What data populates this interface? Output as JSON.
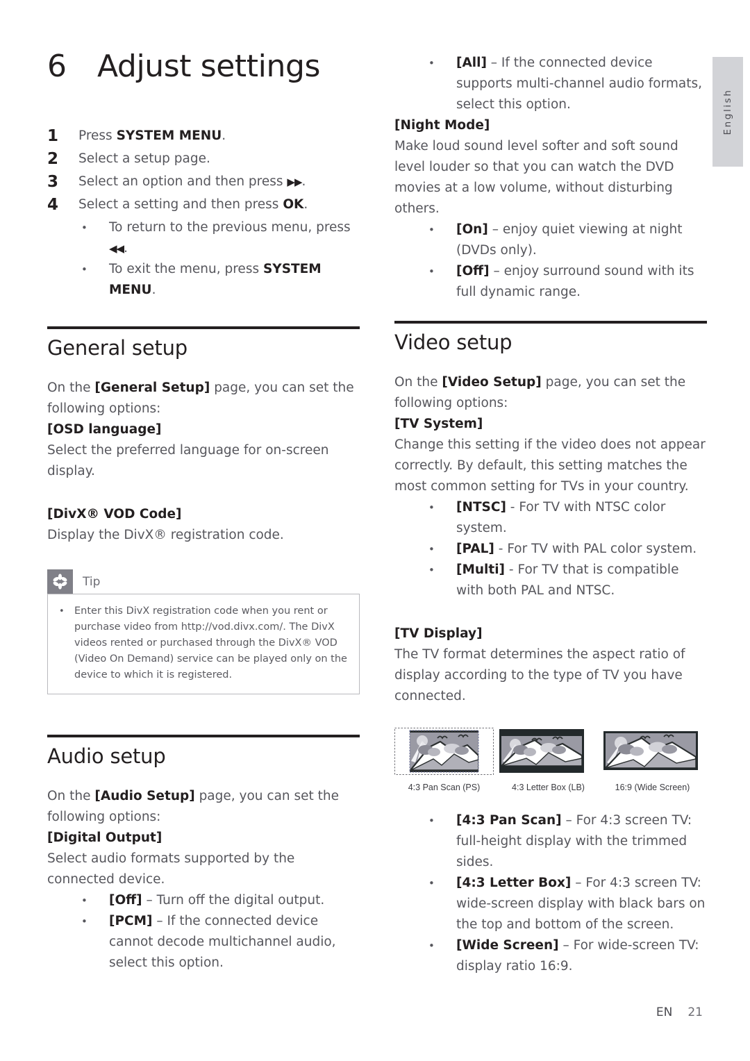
{
  "language_tab": {
    "label": "English"
  },
  "chapter": {
    "number": "6",
    "title": "Adjust settings"
  },
  "steps": [
    {
      "num": "1",
      "text_before": "Press ",
      "bold": "SYSTEM MENU",
      "text_after": "."
    },
    {
      "num": "2",
      "text_before": "Select a setup page.",
      "bold": "",
      "text_after": ""
    },
    {
      "num": "3",
      "text_before": "Select an option and then press ",
      "bold": "",
      "text_after": "."
    },
    {
      "num": "4",
      "text_before": "Select a setting and then press ",
      "bold": "OK",
      "text_after": "."
    }
  ],
  "substeps": [
    {
      "bullet": "•",
      "line1": "To return to the previous menu, press",
      "line2_glyph": "◀◀",
      "line2_after": "."
    },
    {
      "bullet": "•",
      "line1": "To exit the menu, press ",
      "bold": "SYSTEM MENU",
      "line2_after": "."
    }
  ],
  "general_setup": {
    "title": "General setup",
    "intro_before": "On the ",
    "intro_bold": "[General Setup]",
    "intro_after": " page, you can set the following options:",
    "osd_heading": "[OSD language]",
    "osd_body": "Select the preferred language for on-screen display.",
    "divx_heading": "[DivX® VOD Code]",
    "divx_body": "Display the DivX® registration code."
  },
  "tip": {
    "label": "Tip",
    "icon": "asterisk-icon",
    "items": [
      "Enter this DivX registration code when you rent or purchase video from http://vod.divx.com/. The DivX videos rented or purchased through the DivX® VOD (Video On Demand) service can be played only on the device to which it is registered."
    ]
  },
  "audio_setup": {
    "title": "Audio setup",
    "intro_before": "On the ",
    "intro_bold": "[Audio Setup]",
    "intro_after": " page, you can set the following options:",
    "digital_output_heading": "[Digital Output]",
    "digital_output_body": "Select audio formats supported by the connected device.",
    "options": [
      {
        "bold": "[Off]",
        "text": " – Turn off the digital output."
      },
      {
        "bold": "[PCM]",
        "text": " – If the connected device cannot decode multichannel audio, select this option."
      },
      {
        "bold": "[All]",
        "text": " – If the connected device supports multi-channel audio formats, select this option."
      }
    ],
    "night_mode_heading": "[Night Mode]",
    "night_mode_body": "Make loud sound level softer and soft sound level louder so that you can watch the DVD movies at a low volume, without disturbing others.",
    "night_mode_options": [
      {
        "bold": "[On]",
        "text": " – enjoy quiet viewing at night (DVDs only)."
      },
      {
        "bold": "[Off]",
        "text": " – enjoy surround sound with its full dynamic range."
      }
    ]
  },
  "video_setup": {
    "title": "Video setup",
    "intro_before": "On the ",
    "intro_bold": "[Video Setup]",
    "intro_after": " page, you can set the following options:",
    "tv_system_heading": "[TV System]",
    "tv_system_body": "Change this setting if the video does not appear correctly. By default, this setting matches the most common setting for TVs in your country.",
    "tv_system_options": [
      {
        "bold": "[NTSC]",
        "text": " - For TV with NTSC color system."
      },
      {
        "bold": "[PAL]",
        "text": " - For TV with PAL color system."
      },
      {
        "bold": "[Multi]",
        "text": " - For TV that is compatible with both PAL and NTSC."
      }
    ],
    "tv_display_heading": "[TV Display]",
    "tv_display_body": "The TV format determines the aspect ratio of display according to the type of TV you have connected.",
    "figures": [
      {
        "caption": "4:3 Pan Scan (PS)",
        "mode": "panscan"
      },
      {
        "caption": "4:3 Letter Box (LB)",
        "mode": "letterbox"
      },
      {
        "caption": "16:9 (Wide Screen)",
        "mode": "widescreen"
      }
    ],
    "tv_display_options": [
      {
        "bold": "[4:3 Pan Scan]",
        "text": " – For 4:3 screen TV: full-height display with the trimmed sides."
      },
      {
        "bold": "[4:3 Letter Box]",
        "text": " – For 4:3 screen TV: wide-screen display with black bars on the top and bottom of the screen."
      },
      {
        "bold": "[Wide Screen]",
        "text": " – For wide-screen TV: display ratio 16:9."
      }
    ]
  },
  "footer": {
    "lang_code": "EN",
    "page_number": "21"
  }
}
